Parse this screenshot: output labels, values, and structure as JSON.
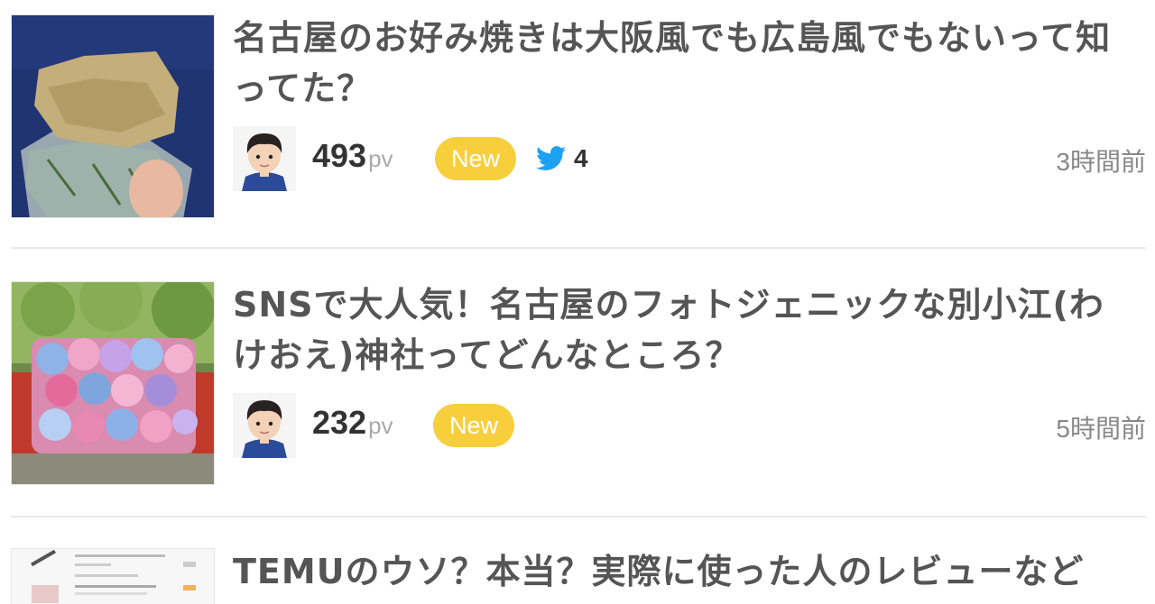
{
  "articles": [
    {
      "title": "名古屋のお好み焼きは大阪風でも広島風でもないって知ってた？",
      "pv": "493",
      "pv_unit": "pv",
      "badge": "New",
      "tweets": "4",
      "time": "3時間前"
    },
    {
      "title": "SNSで大人気！名古屋のフォトジェニックな別小江(わけおえ)神社ってどんなところ？",
      "pv": "232",
      "pv_unit": "pv",
      "badge": "New",
      "time": "5時間前"
    },
    {
      "title": "TEMUのウソ？本当？実際に使った人のレビューなど"
    }
  ],
  "colors": {
    "badge": "#f7cf3d",
    "twitter": "#1da1f2",
    "divider": "#e9e9e9"
  },
  "icons": [
    "twitter-bird-icon",
    "author-avatar"
  ]
}
